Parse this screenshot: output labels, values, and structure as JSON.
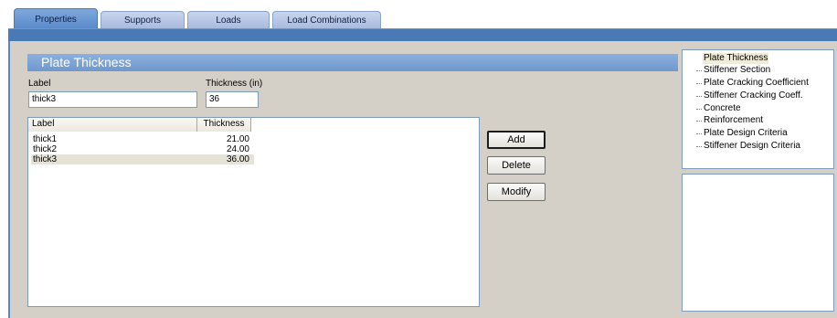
{
  "tabs": [
    {
      "label": "Properties",
      "active": true
    },
    {
      "label": "Supports",
      "active": false
    },
    {
      "label": "Loads",
      "active": false
    },
    {
      "label": "Load Combinations",
      "active": false
    }
  ],
  "section": {
    "title": "Plate Thickness"
  },
  "form": {
    "label_caption": "Label",
    "label_value": "thick3",
    "thickness_caption": "Thickness (in)",
    "thickness_value": "36"
  },
  "table": {
    "columns": [
      "Label",
      "Thickness"
    ],
    "rows": [
      {
        "label": "thick1",
        "thickness": "21.00"
      },
      {
        "label": "thick2",
        "thickness": "24.00"
      },
      {
        "label": "thick3",
        "thickness": "36.00",
        "selected": true
      }
    ]
  },
  "buttons": {
    "add": "Add",
    "delete": "Delete",
    "modify": "Modify"
  },
  "tree": {
    "items": [
      "Plate Thickness",
      "Stiffener Section",
      "Plate Cracking Coefficient",
      "Stiffener Cracking Coeff.",
      "Concrete",
      "Reinforcement",
      "Plate Design Criteria",
      "Stiffener Design Criteria"
    ],
    "selected_index": 0
  },
  "colors": {
    "accent": "#4a7ab5",
    "header_band": "#7fa4d6",
    "panel_bg": "#d4d0c8"
  }
}
